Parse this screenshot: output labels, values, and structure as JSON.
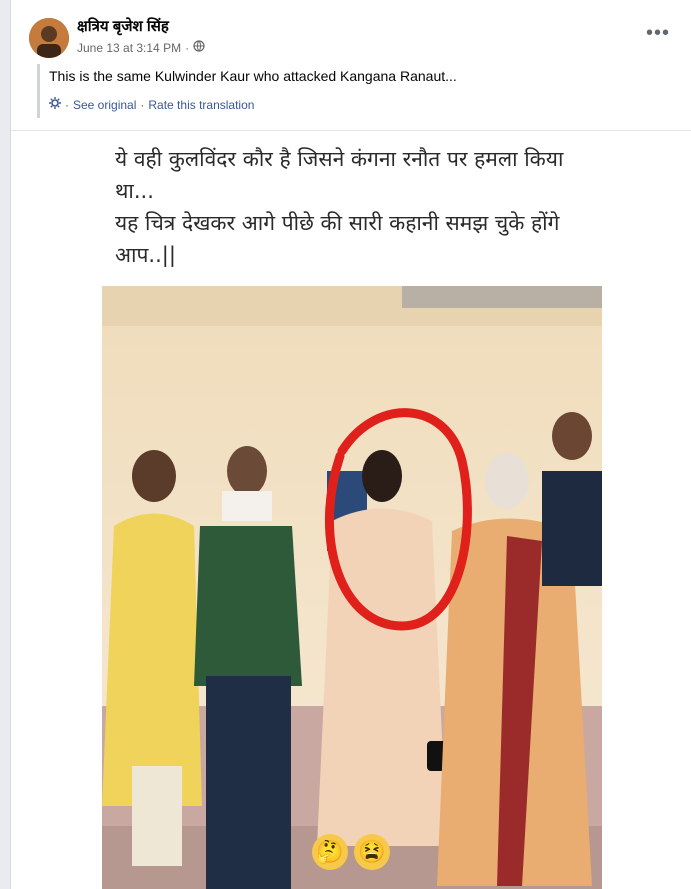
{
  "post": {
    "author": "क्षत्रिय बृजेश सिंह",
    "timestamp": "June 13 at 3:14 PM",
    "separator": "·",
    "translated_text": "This is the same Kulwinder Kaur who attacked Kangana Ranaut...",
    "see_original": "See original",
    "rate_translation": "Rate this translation",
    "link_separator": "·"
  },
  "image": {
    "caption_hindi": "ये वही कुलविंदर कौर है जिसने कंगना रनौत पर हमला किया\nथा...\nयह चित्र देखकर आगे पीछे की सारी कहानी समझ चुके होंगे\nआप..||",
    "emojis": [
      "🤔",
      "😫"
    ]
  },
  "icons": [
    "globe-icon",
    "more-options-icon",
    "translate-gear-icon"
  ],
  "colors": {
    "link": "#385898",
    "meta": "#65676b",
    "annotation_circle": "#e0201b"
  }
}
